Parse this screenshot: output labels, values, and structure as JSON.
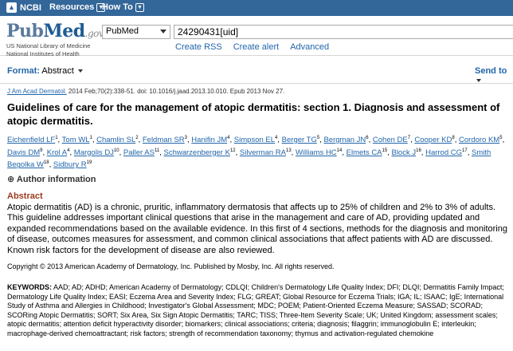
{
  "topbar": {
    "ncbi_label": "NCBI",
    "resources_label": "Resources",
    "howto_label": "How To"
  },
  "header": {
    "brand_pub": "Pub",
    "brand_med": "Med",
    "brand_gov": ".gov",
    "brand_sub1": "US National Library of Medicine",
    "brand_sub2": "National Institutes of Health",
    "db_selected": "PubMed",
    "search_value": "24290431[uid]",
    "links": [
      "Create RSS",
      "Create alert",
      "Advanced"
    ]
  },
  "formatbar": {
    "format_label": "Format:",
    "format_value": "Abstract",
    "send_to": "Send to"
  },
  "article": {
    "journal": "J Am Acad Dermatol.",
    "citation": " 2014 Feb;70(2):338-51. doi: 10.1016/j.jaad.2013.10.010. Epub 2013 Nov 27.",
    "title": "Guidelines of care for the management of atopic dermatitis: section 1. Diagnosis and assessment of atopic dermatitis.",
    "authors": [
      {
        "name": "Eichenfield LF",
        "sup": "1"
      },
      {
        "name": "Tom WL",
        "sup": "1"
      },
      {
        "name": "Chamlin SL",
        "sup": "2"
      },
      {
        "name": "Feldman SR",
        "sup": "3"
      },
      {
        "name": "Hanifin JM",
        "sup": "4"
      },
      {
        "name": "Simpson EL",
        "sup": "4"
      },
      {
        "name": "Berger TG",
        "sup": "5"
      },
      {
        "name": "Bergman JN",
        "sup": "6"
      },
      {
        "name": "Cohen DE",
        "sup": "7"
      },
      {
        "name": "Cooper KD",
        "sup": "8"
      },
      {
        "name": "Cordoro KM",
        "sup": "5"
      },
      {
        "name": "Davis DM",
        "sup": "9"
      },
      {
        "name": "Krol A",
        "sup": "4"
      },
      {
        "name": "Margolis DJ",
        "sup": "10"
      },
      {
        "name": "Paller AS",
        "sup": "11"
      },
      {
        "name": "Schwarzenberger K",
        "sup": "12"
      },
      {
        "name": "Silverman RA",
        "sup": "13"
      },
      {
        "name": "Williams HC",
        "sup": "14"
      },
      {
        "name": "Elmets CA",
        "sup": "15"
      },
      {
        "name": "Block J",
        "sup": "16"
      },
      {
        "name": "Harrod CG",
        "sup": "17"
      },
      {
        "name": "Smith Begolka W",
        "sup": "18"
      },
      {
        "name": "Sidbury R",
        "sup": "19"
      }
    ],
    "author_info_label": "Author information",
    "abstract_heading": "Abstract",
    "abstract_text": "Atopic dermatitis (AD) is a chronic, pruritic, inflammatory dermatosis that affects up to 25% of children and 2% to 3% of adults. This guideline addresses important clinical questions that arise in the management and care of AD, providing updated and expanded recommendations based on the available evidence. In this first of 4 sections, methods for the diagnosis and monitoring of disease, outcomes measures for assessment, and common clinical associations that affect patients with AD are discussed. Known risk factors for the development of disease are also reviewed.",
    "copyright": "Copyright © 2013 American Academy of Dermatology, Inc. Published by Mosby, Inc. All rights reserved.",
    "keywords_label": "KEYWORDS:",
    "keywords_text": " AAD; AD; ADHD; American Academy of Dermatology; CDLQI; Children's Dermatology Life Quality Index; DFI; DLQI; Dermatitis Family Impact; Dermatology Life Quality Index; EASI; Eczema Area and Severity Index; FLG; GREAT; Global Resource for Eczema Trials; IGA; IL; ISAAC; IgE; International Study of Asthma and Allergies in Childhood; Investigator's Global Assessment; MDC; POEM; Patient-Oriented Eczema Measure; SASSAD; SCORAD; SCORing Atopic Dermatitis; SORT; Six Area, Six Sign Atopic Dermatitis; TARC; TISS; Three-Item Severity Scale; UK; United Kingdom; assessment scales; atopic dermatitis; attention deficit hyperactivity disorder; biomarkers; clinical associations; criteria; diagnosis; filaggrin; immunoglobulin E; interleukin; macrophage-derived chemoattractant; risk factors; strength of recommendation taxonomy; thymus and activation-regulated chemokine"
  },
  "colors": {
    "topbar_bg": "#336699",
    "link": "#2266aa",
    "abstract_heading": "#9b3b1e"
  }
}
